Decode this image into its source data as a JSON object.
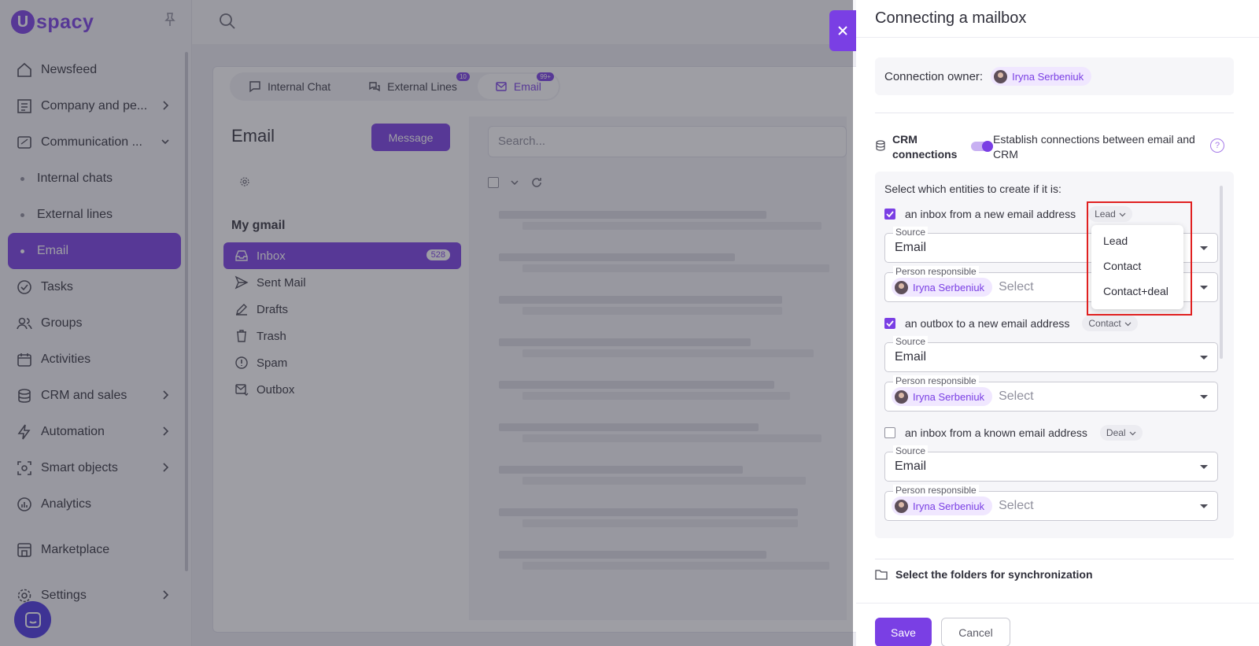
{
  "app": {
    "logo_mark": "U",
    "logo_text": "spacy",
    "accent": "#7a3fe4"
  },
  "sidebar": {
    "items": [
      {
        "label": "Newsfeed",
        "icon": "home-icon"
      },
      {
        "label": "Company and pe...",
        "icon": "company-icon"
      },
      {
        "label": "Communication ...",
        "icon": "communication-icon"
      },
      {
        "label": "Internal chats"
      },
      {
        "label": "External lines"
      },
      {
        "label": "Email"
      },
      {
        "label": "Tasks",
        "icon": "tasks-icon"
      },
      {
        "label": "Groups",
        "icon": "groups-icon"
      },
      {
        "label": "Activities",
        "icon": "calendar-icon"
      },
      {
        "label": "CRM and sales",
        "icon": "crm-icon"
      },
      {
        "label": "Automation",
        "icon": "lightning-icon"
      },
      {
        "label": "Smart objects",
        "icon": "smart-objects-icon"
      },
      {
        "label": "Analytics",
        "icon": "analytics-icon"
      },
      {
        "label": "Marketplace",
        "icon": "marketplace-icon"
      },
      {
        "label": "Settings",
        "icon": "gear-icon"
      }
    ]
  },
  "main": {
    "tabs": [
      {
        "label": "Internal Chat"
      },
      {
        "label": "External Lines",
        "badge": "10"
      },
      {
        "label": "Email",
        "badge": "99+"
      }
    ],
    "title": "Email",
    "message_button": "Message",
    "account": "My gmail",
    "folders": [
      {
        "label": "Inbox",
        "count": "528"
      },
      {
        "label": "Sent Mail"
      },
      {
        "label": "Drafts"
      },
      {
        "label": "Trash"
      },
      {
        "label": "Spam"
      },
      {
        "label": "Outbox"
      }
    ],
    "search_placeholder": "Search..."
  },
  "drawer": {
    "title": "Connecting a mailbox",
    "owner_label": "Connection owner:",
    "owner_name": "Iryna Serbeniuk",
    "crm_label": "CRM connections",
    "crm_desc": "Establish connections between email and CRM",
    "help": "?",
    "entities_title": "Select which entities to create if it is:",
    "rules": [
      {
        "label": "an inbox from a new email address",
        "checked": true,
        "entity": "Lead",
        "source_label": "Source",
        "source_value": "Email",
        "person_label": "Person responsible",
        "person_name": "Iryna Serbeniuk",
        "person_placeholder": "Select"
      },
      {
        "label": "an outbox to a new email address",
        "checked": true,
        "entity": "Contact",
        "source_label": "Source",
        "source_value": "Email",
        "person_label": "Person responsible",
        "person_name": "Iryna Serbeniuk",
        "person_placeholder": "Select"
      },
      {
        "label": "an inbox from a known email address",
        "checked": false,
        "entity": "Deal",
        "source_label": "Source",
        "source_value": "Email",
        "person_label": "Person responsible",
        "person_name": "Iryna Serbeniuk",
        "person_placeholder": "Select"
      }
    ],
    "folders_sync": "Select the folders for synchronization",
    "save": "Save",
    "cancel": "Cancel"
  },
  "dropdown": {
    "options": [
      "Lead",
      "Contact",
      "Contact+deal"
    ]
  }
}
